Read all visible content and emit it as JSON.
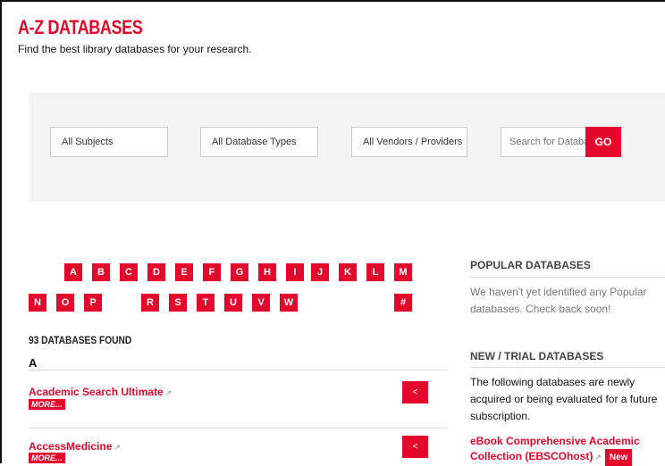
{
  "page": {
    "title": "A-Z DATABASES",
    "subtitle": "Find the best library databases for your research."
  },
  "filters": {
    "subjects": "All Subjects",
    "types": "All Database Types",
    "vendors": "All Vendors / Providers",
    "search_placeholder": "Search for Databases",
    "go_label": "GO"
  },
  "alphabet": {
    "row1": [
      "A",
      "B",
      "C",
      "D",
      "E",
      "F",
      "G",
      "H",
      "I",
      "J",
      "K",
      "L",
      "M"
    ],
    "row2": [
      "N",
      "O",
      "P",
      "R",
      "S",
      "T",
      "U",
      "V",
      "W",
      "#"
    ]
  },
  "results": {
    "count_label": "93 DATABASES FOUND",
    "section_letter": "A",
    "items": [
      {
        "name": "Academic Search Ultimate",
        "more": "MORE..."
      },
      {
        "name": "AccessMedicine",
        "more": "MORE..."
      }
    ],
    "ext_icon": "external-link-icon",
    "share_icon": "share-icon"
  },
  "sidebar": {
    "popular_heading": "POPULAR DATABASES",
    "popular_text": "We haven't yet identified any Popular databases. Check back soon!",
    "new_heading": "NEW / TRIAL DATABASES",
    "new_text": "The following databases are newly acquired or being evaluated for a future subscription.",
    "new_item": "eBook Comprehensive Academic Collection (EBSCOhost)",
    "new_badge": "New"
  },
  "colors": {
    "accent": "#e4062b"
  }
}
